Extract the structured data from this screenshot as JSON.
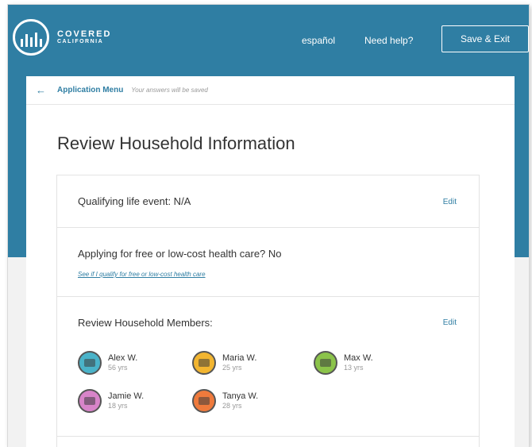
{
  "header": {
    "logo_line1": "COVERED",
    "logo_line2": "CALIFORNIA",
    "language_link": "español",
    "help_link": "Need help?",
    "exit_button": "Save & Exit"
  },
  "menu_bar": {
    "back_icon": "arrow-left-icon",
    "menu_link": "Application Menu",
    "saved_note": "Your answers will be saved"
  },
  "page_title": "Review Household Information",
  "sections": {
    "life_event": {
      "text": "Qualifying life event: N/A",
      "edit": "Edit"
    },
    "health_care": {
      "text": "Applying for free or low-cost health care? No",
      "link": "See if I qualify for free or low-cost health care"
    },
    "members_section": {
      "title": "Review Household Members:",
      "edit": "Edit"
    }
  },
  "members": [
    {
      "name": "Alex W.",
      "age": "56 yrs",
      "avatar_color": "#4ab3c9",
      "icon": "building-icon"
    },
    {
      "name": "Maria W.",
      "age": "25 yrs",
      "avatar_color": "#f2b530",
      "icon": "bridge-icon"
    },
    {
      "name": "Max W.",
      "age": "13 yrs",
      "avatar_color": "#8bc34a",
      "icon": "capsule-icon"
    },
    {
      "name": "Jamie W.",
      "age": "18 yrs",
      "avatar_color": "#d884c9",
      "icon": "bear-icon"
    },
    {
      "name": "Tanya W.",
      "age": "28 yrs",
      "avatar_color": "#ef7a3c",
      "icon": "leaf-icon"
    }
  ],
  "colors": {
    "brand_blue": "#2f7ea3",
    "link_blue": "#2f7ea3"
  }
}
